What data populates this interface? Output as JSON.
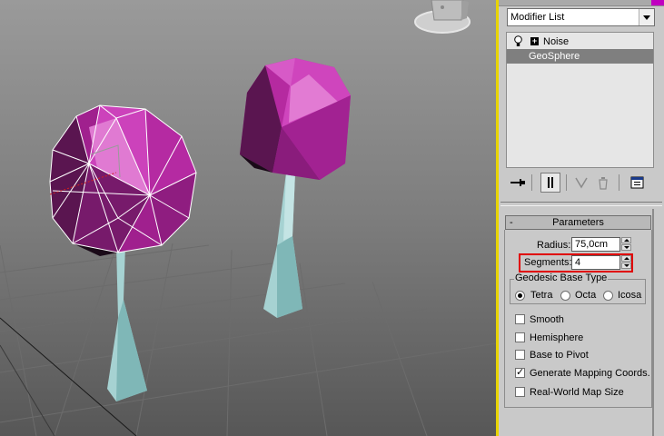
{
  "modifier_list": {
    "label": "Modifier List"
  },
  "stack": [
    {
      "label": "Noise",
      "selected": false
    },
    {
      "label": "GeoSphere",
      "selected": true
    }
  ],
  "rollout": {
    "title": "Parameters",
    "collapse": "-"
  },
  "params": {
    "radius_label": "Radius:",
    "radius_value": "75,0cm",
    "segments_label": "Segments:",
    "segments_value": "4"
  },
  "geodesic": {
    "title": "Geodesic Base Type",
    "options": [
      {
        "label": "Tetra",
        "selected": true
      },
      {
        "label": "Octa",
        "selected": false
      },
      {
        "label": "Icosa",
        "selected": false
      }
    ]
  },
  "checkboxes": [
    {
      "label": "Smooth",
      "checked": false
    },
    {
      "label": "Hemisphere",
      "checked": false
    },
    {
      "label": "Base to Pivot",
      "checked": false
    },
    {
      "label": "Generate Mapping Coords.",
      "checked": true
    },
    {
      "label": "Real-World Map Size",
      "checked": false
    }
  ],
  "colors": {
    "selection_highlight": "#e00000",
    "viewport_divider": "#e8d400",
    "geosphere": "#b0209e",
    "trunk": "#a8d4d4"
  }
}
